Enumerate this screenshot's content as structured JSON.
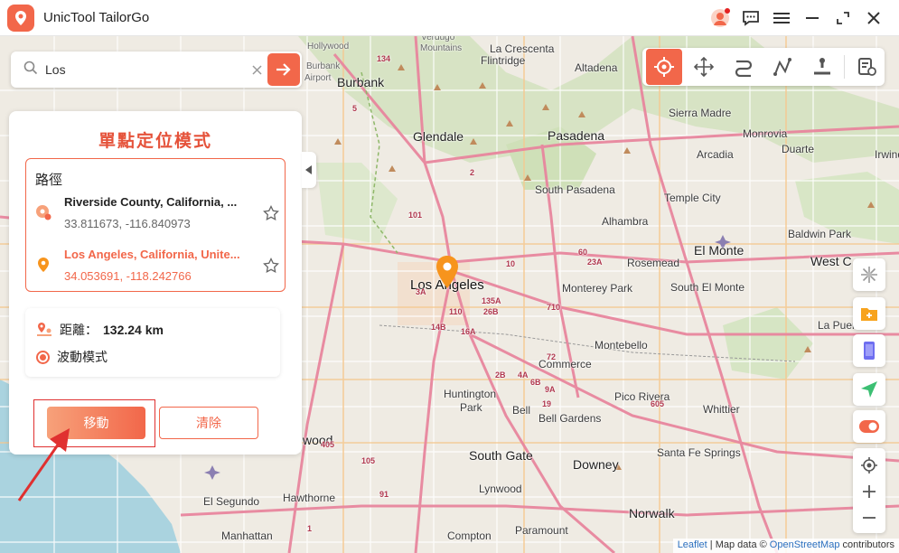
{
  "app": {
    "title": "UnicTool TailorGo"
  },
  "search": {
    "value": "Los"
  },
  "panel": {
    "title": "單點定位模式",
    "route_label": "路徑",
    "start": {
      "name": "Riverside County, California, ...",
      "coords": "33.811673, -116.840973"
    },
    "destination": {
      "name": "Los Angeles, California, Unite...",
      "coords": "34.053691, -118.242766"
    },
    "distance_label": "距離：",
    "distance_value": "132.24 km",
    "wave_mode_label": "波動模式",
    "move_button": "移動",
    "clear_button": "清除"
  },
  "map": {
    "places": [
      {
        "t": "Verdugo",
        "c": "small"
      },
      {
        "t": "Mountains",
        "c": "small"
      },
      {
        "t": "La Crescenta",
        "c": ""
      },
      {
        "t": "Flintridge",
        "c": ""
      },
      {
        "t": "Burbank",
        "c": "big"
      },
      {
        "t": "Altadena",
        "c": ""
      },
      {
        "t": "Sierra Madre",
        "c": ""
      },
      {
        "t": "Glendale",
        "c": "big"
      },
      {
        "t": "Pasadena",
        "c": "big"
      },
      {
        "t": "Monrovia",
        "c": ""
      },
      {
        "t": "Arcadia",
        "c": ""
      },
      {
        "t": "Duarte",
        "c": ""
      },
      {
        "t": "Irwindale",
        "c": ""
      },
      {
        "t": "South Pasadena",
        "c": ""
      },
      {
        "t": "Temple City",
        "c": ""
      },
      {
        "t": "Alhambra",
        "c": ""
      },
      {
        "t": "Baldwin Park",
        "c": ""
      },
      {
        "t": "Rosemead",
        "c": ""
      },
      {
        "t": "El Monte",
        "c": "big"
      },
      {
        "t": "West C",
        "c": "big"
      },
      {
        "t": "Los Angeles",
        "c": "bigger"
      },
      {
        "t": "Monterey Park",
        "c": ""
      },
      {
        "t": "South El Monte",
        "c": ""
      },
      {
        "t": "Montebello",
        "c": ""
      },
      {
        "t": "La Puente",
        "c": ""
      },
      {
        "t": "Commerce",
        "c": ""
      },
      {
        "t": "Huntington",
        "c": ""
      },
      {
        "t": "Park",
        "c": ""
      },
      {
        "t": "Pico Rivera",
        "c": ""
      },
      {
        "t": "Bell",
        "c": ""
      },
      {
        "t": "Bell Gardens",
        "c": ""
      },
      {
        "t": "Whittier",
        "c": ""
      },
      {
        "t": "wood",
        "c": "big"
      },
      {
        "t": "South Gate",
        "c": "big"
      },
      {
        "t": "Downey",
        "c": "big"
      },
      {
        "t": "Santa Fe Springs",
        "c": ""
      },
      {
        "t": "Lynwood",
        "c": ""
      },
      {
        "t": "Hawthorne",
        "c": ""
      },
      {
        "t": "El Segundo",
        "c": ""
      },
      {
        "t": "Norwalk",
        "c": "big"
      },
      {
        "t": "Paramount",
        "c": ""
      },
      {
        "t": "Manhattan",
        "c": ""
      },
      {
        "t": "Compton",
        "c": ""
      },
      {
        "t": "Hollywood",
        "c": "small"
      },
      {
        "t": "Burbank",
        "c": "small"
      },
      {
        "t": "Airport",
        "c": "small"
      }
    ],
    "shields": [
      "5",
      "134",
      "2",
      "110",
      "10",
      "101",
      "60",
      "710",
      "605",
      "105",
      "405",
      "91",
      "19",
      "72",
      "1",
      "14B",
      "16A",
      "135A",
      "23A",
      "26B",
      "2B",
      "4A",
      "6B",
      "9A",
      "3A"
    ]
  },
  "attribution": {
    "leaflet": "Leaflet",
    "mid": "| Map data ©",
    "osm": "OpenStreetMap",
    "end": "contributors"
  },
  "colors": {
    "accent": "#f2674a",
    "map_bg": "#efebe3",
    "highlight": "#e03030"
  }
}
